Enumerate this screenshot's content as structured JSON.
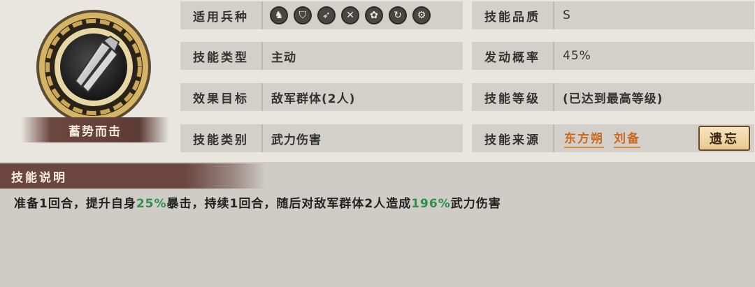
{
  "skill": {
    "name": "蓄势而击",
    "icon": "sword-emblem-icon"
  },
  "fields": {
    "troop_type_label": "适用兵种",
    "troop_types": [
      {
        "icon": "cavalry-icon",
        "glyph": "♞"
      },
      {
        "icon": "shield-icon",
        "glyph": "⛉"
      },
      {
        "icon": "bow-icon",
        "glyph": "➶"
      },
      {
        "icon": "spear-icon",
        "glyph": "✕"
      },
      {
        "icon": "siege-icon",
        "glyph": "✿"
      },
      {
        "icon": "navy-icon",
        "glyph": "↻"
      },
      {
        "icon": "machine-icon",
        "glyph": "⚙"
      }
    ],
    "skill_type_label": "技能类型",
    "skill_type": "主动",
    "target_label": "效果目标",
    "target": "敌军群体(2人)",
    "category_label": "技能类别",
    "category": "武力伤害",
    "quality_label": "技能品质",
    "quality": "S",
    "trigger_rate_label": "发动概率",
    "trigger_rate": "45%",
    "level_label": "技能等级",
    "level": "(已达到最高等级)",
    "source_label": "技能来源",
    "sources": [
      "东方朔",
      "刘备"
    ],
    "forget_button": "遗忘"
  },
  "description": {
    "title": "技能说明",
    "part1": "准备1回合，提升自身",
    "value1": "25%",
    "part2": "暴击，持续1回合，随后对敌军群体2人造成",
    "value2": "196%",
    "part3": "武力伤害"
  },
  "colors": {
    "highlight": "#2f8f4a",
    "source_link": "#c86a1c",
    "banner": "#6b4740"
  }
}
